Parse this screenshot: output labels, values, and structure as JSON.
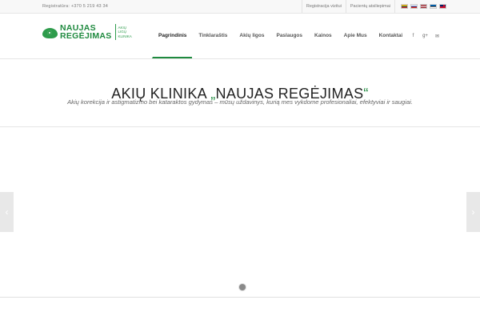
{
  "topbar": {
    "phone": "Registratūra: +370 5 219 43 34",
    "links": [
      "Registracija vizitui",
      "Pacientų atsiliepimai"
    ],
    "flags": [
      "lt-flag",
      "ru-flag",
      "lv-flag",
      "ee-flag",
      "gb-flag"
    ]
  },
  "logo": {
    "line1": "NAUJAS",
    "line2": "REGĖJIMAS",
    "sub": [
      "AKIŲ",
      "LIGŲ",
      "KLINIKA"
    ],
    "color": "#1f8a3f"
  },
  "nav": {
    "items": [
      "Pagrindinis",
      "Tinklaraštis",
      "Akių ligos",
      "Paslaugos",
      "Kainos",
      "Apie Mus",
      "Kontaktai"
    ],
    "active_index": 0
  },
  "social": {
    "facebook": "f",
    "googleplus": "g+",
    "mail": "✉"
  },
  "hero": {
    "title_main": "AKIŲ KLINIKA ",
    "quote_open": "„",
    "title_name": "NAUJAS REGĖJIMAS",
    "quote_close": "“",
    "subtitle": "Akių korekcija ir astigmatizmo bei kataraktos gydymas – mūsų uždavinys, kurią mes vykdome profesionaliai, efektyviai ir saugiai."
  },
  "slider": {
    "prev_icon": "‹",
    "next_icon": "›"
  }
}
